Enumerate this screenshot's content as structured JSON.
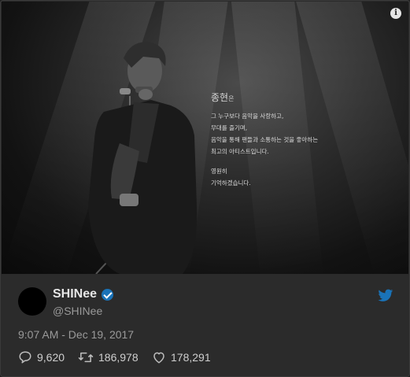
{
  "media": {
    "poem": {
      "name": "종현",
      "name_suffix": "은",
      "lines1": [
        "그 누구보다 음악을 사랑하고,",
        "무대를 즐기며,",
        "음악을 통해 팬들과 소통하는 것을 좋아하는",
        "최고의 아티스트입니다."
      ],
      "lines2": [
        "영원히",
        "기억하겠습니다."
      ]
    },
    "info_icon": "i"
  },
  "author": {
    "display_name": "SHINee",
    "handle": "@SHINee",
    "verified": true
  },
  "timestamp": "9:07 AM - Dec 19, 2017",
  "actions": {
    "replies": "9,620",
    "retweets": "186,978",
    "likes": "178,291"
  },
  "icons": [
    "info-icon",
    "verified-badge-icon",
    "twitter-bird-icon",
    "reply-icon",
    "retweet-icon",
    "like-icon"
  ]
}
